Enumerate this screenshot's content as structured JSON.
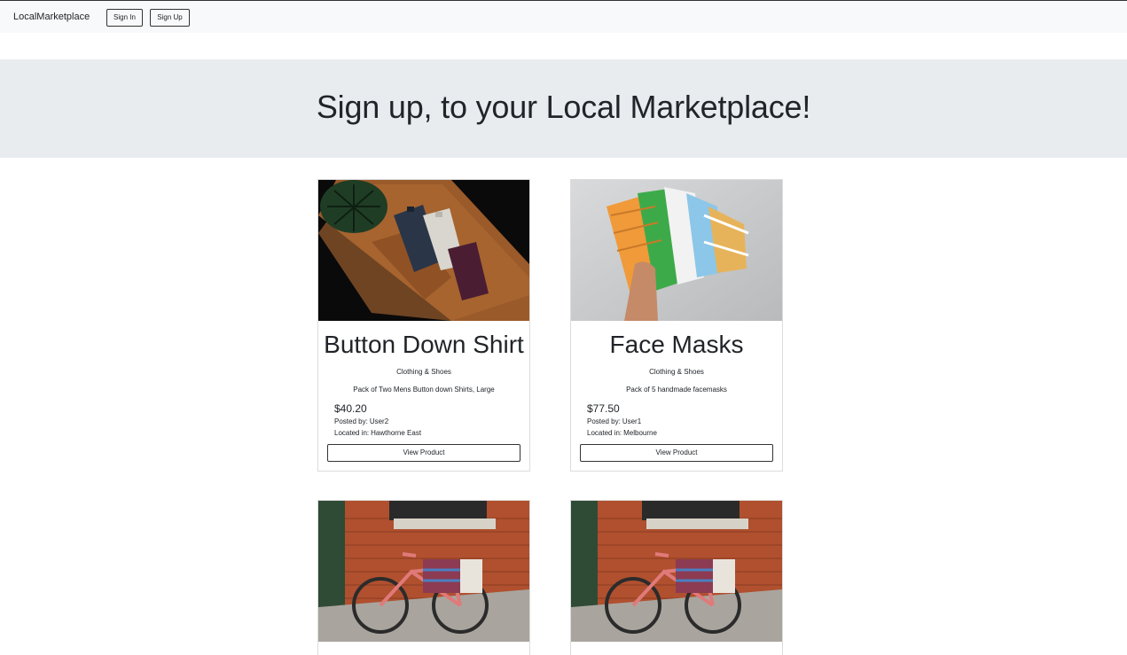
{
  "nav": {
    "brand": "LocalMarketplace",
    "sign_in": "Sign In",
    "sign_up": "Sign Up"
  },
  "hero": {
    "heading": "Sign up, to your Local Marketplace!"
  },
  "products": [
    {
      "title": "Button Down Shirt",
      "category": "Clothing & Shoes",
      "description": "Pack of Two Mens Button down Shirts, Large",
      "price": "$40.20",
      "posted_label": "Posted by:",
      "posted_by": "User2",
      "location_label": "Located in:",
      "location": "Hawthorne East",
      "button": "View Product",
      "image": "shirts-photo"
    },
    {
      "title": "Face Masks",
      "category": "Clothing & Shoes",
      "description": "Pack of 5 handmade facemasks",
      "price": "$77.50",
      "posted_label": "Posted by:",
      "posted_by": "User1",
      "location_label": "Located in:",
      "location": "Melbourne",
      "button": "View Product",
      "image": "masks-photo"
    },
    {
      "image": "bicycle-photo"
    },
    {
      "image": "bicycle-photo"
    }
  ],
  "colors": {
    "navbar_bg": "#f8f9fa",
    "hero_bg": "#e9ecef",
    "text": "#212529",
    "border": "#333333"
  }
}
